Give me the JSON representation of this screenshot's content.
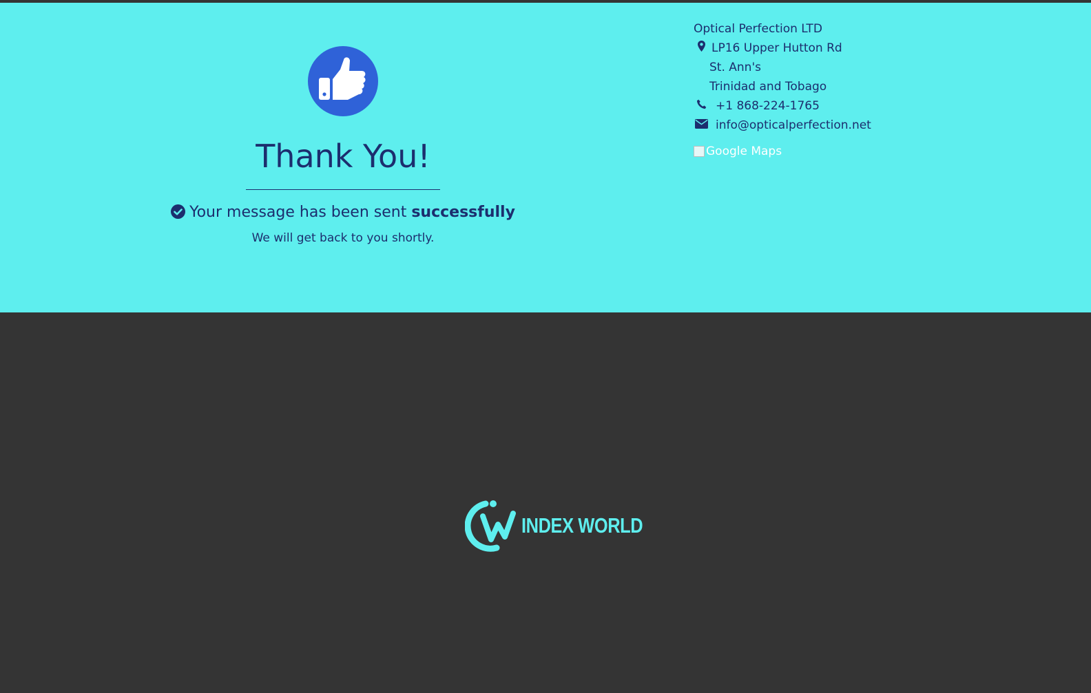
{
  "confirmation": {
    "heading": "Thank You!",
    "message_prefix": "Your message has been sent ",
    "message_emphasis": "successfully",
    "subtext": "We will get back to you shortly."
  },
  "contact": {
    "company": "Optical Perfection LTD",
    "address_line1": "LP16 Upper Hutton Rd",
    "address_line2": "St. Ann's",
    "address_line3": "Trinidad and Tobago",
    "phone": "+1 868-224-1765",
    "email": "info@opticalperfection.net",
    "map_alt": "Google Maps"
  },
  "footer": {
    "logo_text": "INDEX WORLD"
  },
  "colors": {
    "hero_bg": "#5eeeee",
    "footer_bg": "#343434",
    "text": "#1c2e6e",
    "thumb_circle": "#2f62d8"
  },
  "icons": [
    "thumbs-up-icon",
    "check-circle-icon",
    "map-marker-icon",
    "phone-icon",
    "envelope-icon"
  ]
}
